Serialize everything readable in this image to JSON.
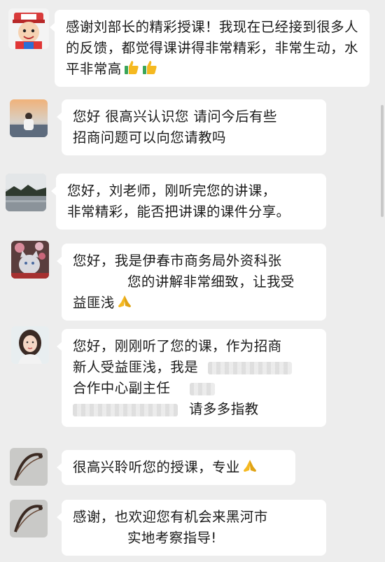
{
  "messages": [
    {
      "avatar": "cartoon-avatar",
      "lines": [
        "感谢刘部长的精彩授课！我现在已经接到很多人",
        "的反馈，都觉得课讲得非常精彩，非常生动，水",
        "平非常高"
      ],
      "trailing_emoji": [
        "thumbs-up-icon",
        "thumbs-up-icon"
      ]
    },
    {
      "avatar": "sunset-person-avatar",
      "lines": [
        "您好 很高兴认识您 请问今后有些",
        "招商问题可以向您请教吗"
      ]
    },
    {
      "avatar": "lake-landscape-avatar",
      "lines": [
        "您好，刘老师，刚听完您的讲课，",
        "非常精彩，能否把讲课的课件分享。"
      ]
    },
    {
      "avatar": "cat-flowers-avatar",
      "lines": [
        "您好，我是伊春市商务局外资科张",
        "您的讲解非常细致，让我受",
        "益匪浅"
      ],
      "trailing_emoji": [
        "folded-hands-icon"
      ]
    },
    {
      "avatar": "woman-portrait-avatar",
      "lines": [
        "您好，刚刚听了您的课，作为招商",
        "新人受益匪浅，我是",
        "合作中心副主任",
        "请多多指教"
      ]
    },
    {
      "avatar": "bow-avatar",
      "lines": [
        "很高兴聆听您的授课，专业"
      ],
      "trailing_emoji": [
        "folded-hands-icon"
      ]
    },
    {
      "avatar": "bow-avatar",
      "lines": [
        "感谢，也欢迎您有机会来黑河市",
        "实地考察指导!"
      ]
    }
  ],
  "colors": {
    "background": "#ededed",
    "bubble": "#ffffff",
    "text": "#1a1a1a"
  }
}
